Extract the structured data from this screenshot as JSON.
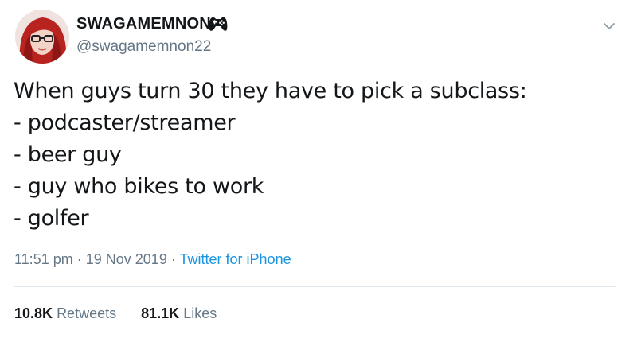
{
  "tweet": {
    "author": {
      "display_name": "SWAGAMEMNON",
      "badge_icon": "gamepad-icon",
      "handle": "@swagamemnon22"
    },
    "menu_icon": "chevron-down-icon",
    "text_lines": [
      "When guys turn 30 they have to pick a subclass:",
      "- podcaster/streamer",
      "- beer guy",
      "- guy who bikes to work",
      "- golfer"
    ],
    "time": "11:51 pm",
    "separator": "·",
    "date": "19 Nov 2019",
    "source": "Twitter for iPhone",
    "stats": {
      "retweets_count": "10.8K",
      "retweets_label": "Retweets",
      "likes_count": "81.1K",
      "likes_label": "Likes"
    }
  },
  "colors": {
    "text": "#14171a",
    "secondary": "#657786",
    "link": "#1b95e0",
    "divider": "#e1e8ed"
  }
}
